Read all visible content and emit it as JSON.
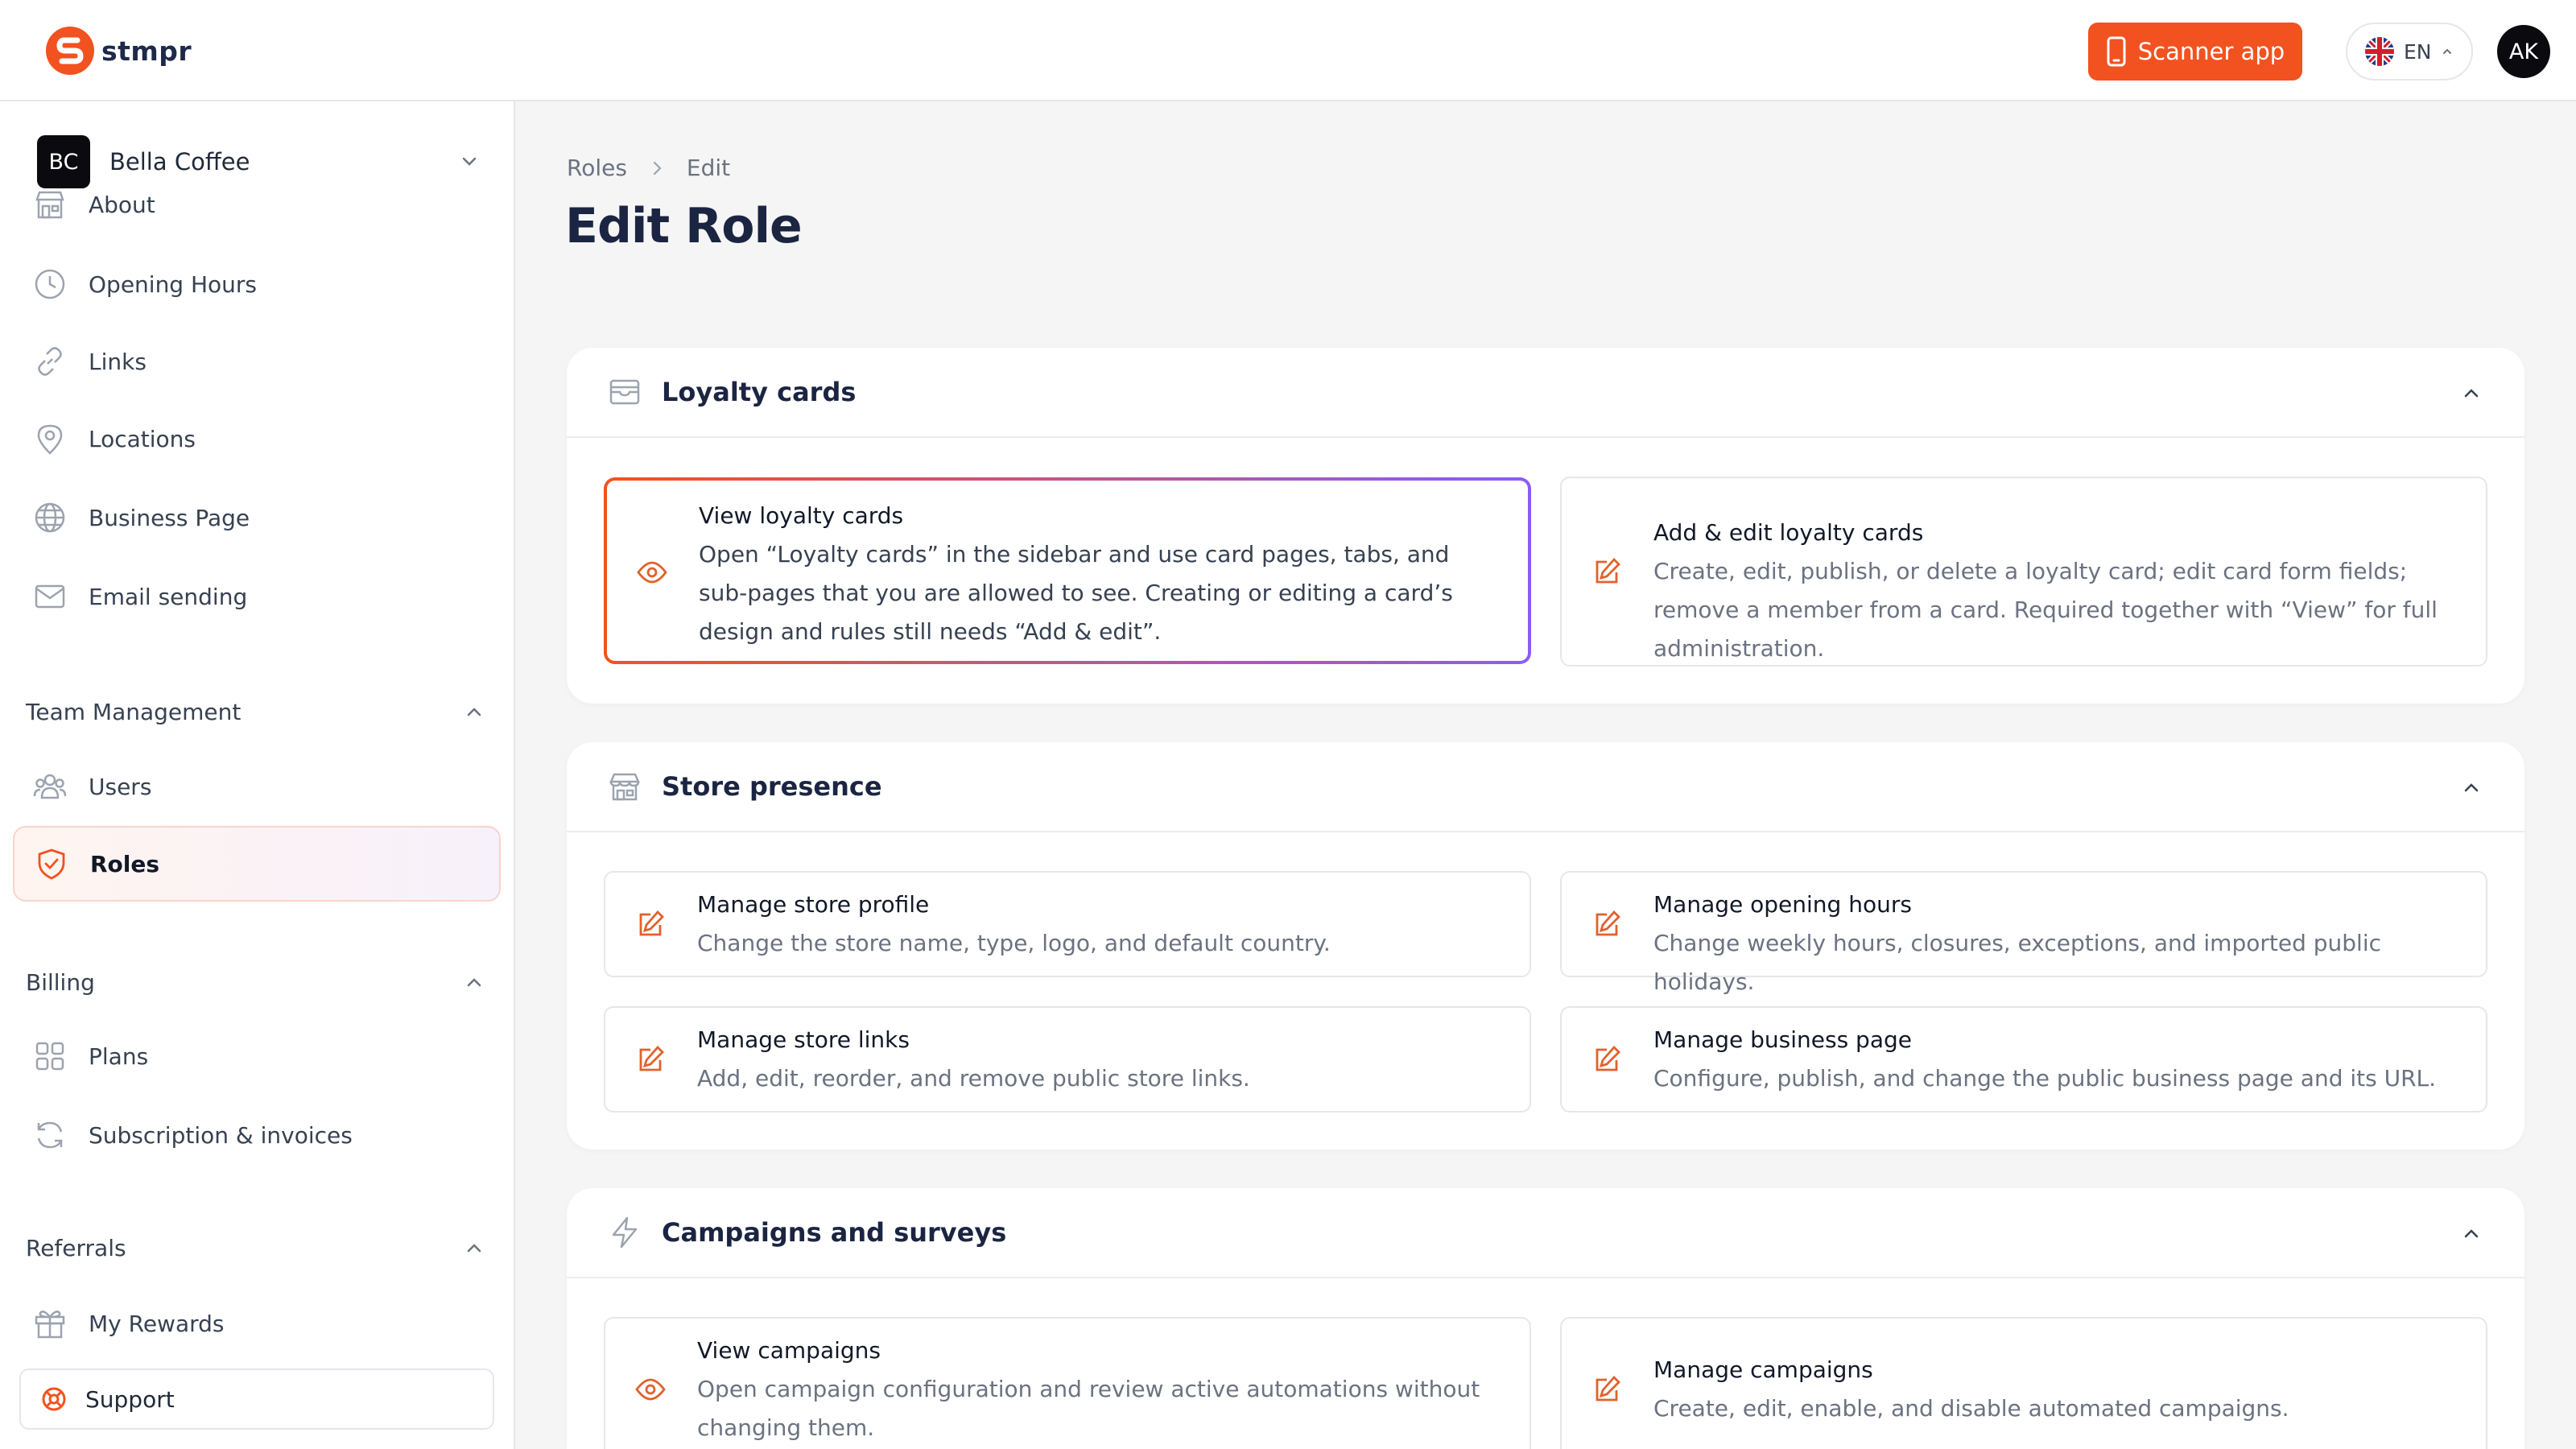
{
  "app": {
    "brand": "stmpr",
    "scanner_label": "Scanner app",
    "language": "EN",
    "user_initials": "AK"
  },
  "sidebar": {
    "store": {
      "initials": "BC",
      "name": "Bella Coffee"
    },
    "items": [
      {
        "label": "About",
        "icon": "store-icon"
      },
      {
        "label": "Opening Hours",
        "icon": "clock-icon"
      },
      {
        "label": "Links",
        "icon": "link-icon"
      },
      {
        "label": "Locations",
        "icon": "map-pin-icon"
      },
      {
        "label": "Business Page",
        "icon": "globe-icon"
      },
      {
        "label": "Email sending",
        "icon": "mail-icon"
      }
    ],
    "team": {
      "title": "Team Management",
      "items": [
        {
          "label": "Users",
          "icon": "users-icon"
        },
        {
          "label": "Roles",
          "icon": "shield-icon",
          "active": true
        }
      ]
    },
    "billing": {
      "title": "Billing",
      "items": [
        {
          "label": "Plans",
          "icon": "grid-icon"
        },
        {
          "label": "Subscription & invoices",
          "icon": "refresh-icon"
        }
      ]
    },
    "referrals": {
      "title": "Referrals",
      "items": [
        {
          "label": "My Rewards",
          "icon": "gift-icon"
        }
      ]
    },
    "support_label": "Support"
  },
  "breadcrumb": {
    "root": "Roles",
    "current": "Edit"
  },
  "page_title": "Edit Role",
  "sections": [
    {
      "title": "Loyalty cards",
      "icon": "wallet-icon",
      "permissions": [
        {
          "title": "View loyalty cards",
          "description": "Open “Loyalty cards” in the sidebar and use card pages, tabs, and sub-pages that you are allowed to see. Creating or editing a card’s design and rules still needs “Add & edit”.",
          "icon": "eye-icon",
          "selected": true
        },
        {
          "title": "Add & edit loyalty cards",
          "description": "Create, edit, publish, or delete a loyalty card; edit card form fields; remove a member from a card. Required together with “View” for full administration.",
          "icon": "edit-icon",
          "selected": false
        }
      ]
    },
    {
      "title": "Store presence",
      "icon": "store-icon",
      "permissions": [
        {
          "title": "Manage store profile",
          "description": "Change the store name, type, logo, and default country.",
          "icon": "edit-icon"
        },
        {
          "title": "Manage opening hours",
          "description": "Change weekly hours, closures, exceptions, and imported public holidays.",
          "icon": "edit-icon"
        },
        {
          "title": "Manage store links",
          "description": "Add, edit, reorder, and remove public store links.",
          "icon": "edit-icon"
        },
        {
          "title": "Manage business page",
          "description": "Configure, publish, and change the public business page and its URL.",
          "icon": "edit-icon"
        }
      ]
    },
    {
      "title": "Campaigns and surveys",
      "icon": "zap-icon",
      "permissions": [
        {
          "title": "View campaigns",
          "description": "Open campaign configuration and review active automations without changing them.",
          "icon": "eye-icon"
        },
        {
          "title": "Manage campaigns",
          "description": "Create, edit, enable, and disable automated campaigns.",
          "icon": "edit-icon"
        }
      ]
    }
  ],
  "colors": {
    "accent": "#f2521f",
    "gradient_end": "#8b5cf6",
    "title": "#1b2542",
    "muted": "#6b7280"
  }
}
